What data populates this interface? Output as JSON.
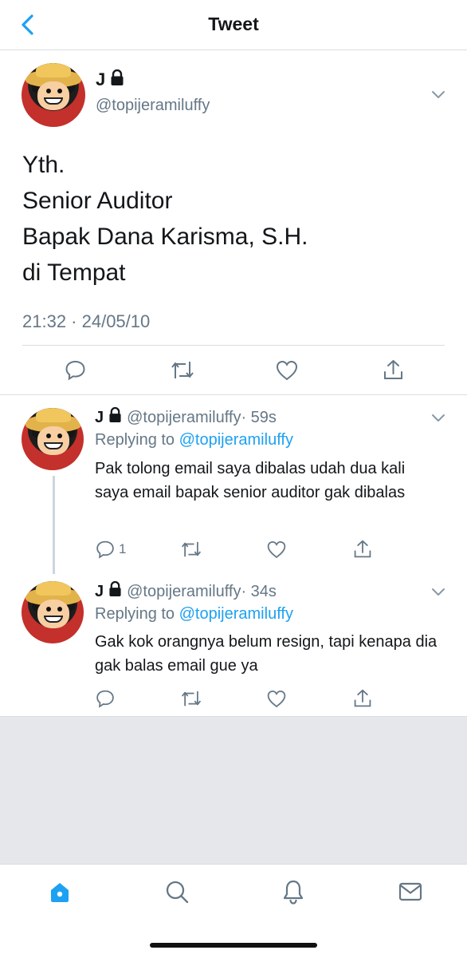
{
  "header": {
    "title": "Tweet"
  },
  "main_tweet": {
    "name": "J",
    "handle": "@topijeramiluffy",
    "text": "Yth.\nSenior Auditor\nBapak Dana Karisma, S.H.\ndi Tempat",
    "timestamp": "21:32 · 24/05/10"
  },
  "replies": [
    {
      "name": "J",
      "handle": "@topijeramiluffy",
      "time": "· 59s",
      "replying_label": "Replying to",
      "replying_to": "@topijeramiluffy",
      "text": "Pak tolong email saya dibalas udah dua kali saya email bapak senior auditor gak dibalas",
      "reply_count": "1"
    },
    {
      "name": "J",
      "handle": "@topijeramiluffy",
      "time": "· 34s",
      "replying_label": "Replying to",
      "replying_to": "@topijeramiluffy",
      "text": "Gak kok orangnya belum resign, tapi kenapa dia gak balas email gue ya",
      "reply_count": ""
    }
  ],
  "icons": {
    "back": "chevron-left-icon",
    "more": "chevron-down-icon",
    "reply": "comment-icon",
    "retweet": "retweet-icon",
    "like": "heart-icon",
    "share": "share-icon",
    "lock": "lock-icon",
    "home": "home-icon",
    "search": "search-icon",
    "notifications": "bell-icon",
    "messages": "mail-icon"
  },
  "colors": {
    "accent": "#1da1f2",
    "text": "#14171a",
    "secondary": "#657786",
    "divider": "#d9dde1",
    "empty_area": "#e6e7eb"
  }
}
